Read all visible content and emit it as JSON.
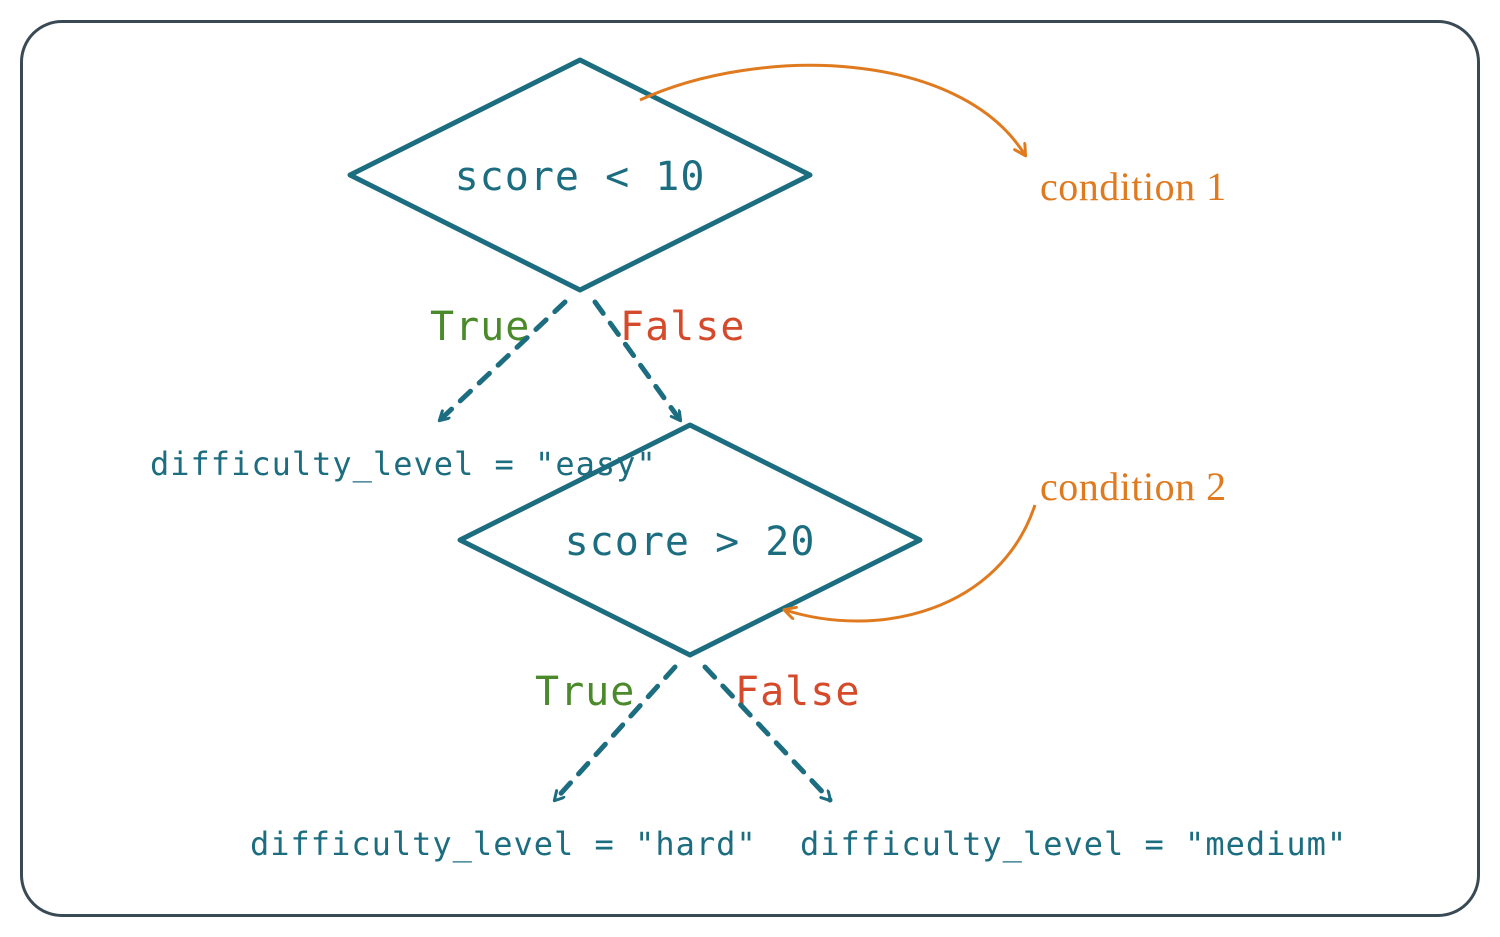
{
  "diamond1": {
    "text": "score < 10",
    "annotation": "condition 1"
  },
  "branch1": {
    "true_label": "True",
    "false_label": "False",
    "true_result": "difficulty_level = \"easy\""
  },
  "diamond2": {
    "text": "score > 20",
    "annotation": "condition 2"
  },
  "branch2": {
    "true_label": "True",
    "false_label": "False",
    "true_result": "difficulty_level = \"hard\"",
    "false_result": "difficulty_level = \"medium\""
  }
}
